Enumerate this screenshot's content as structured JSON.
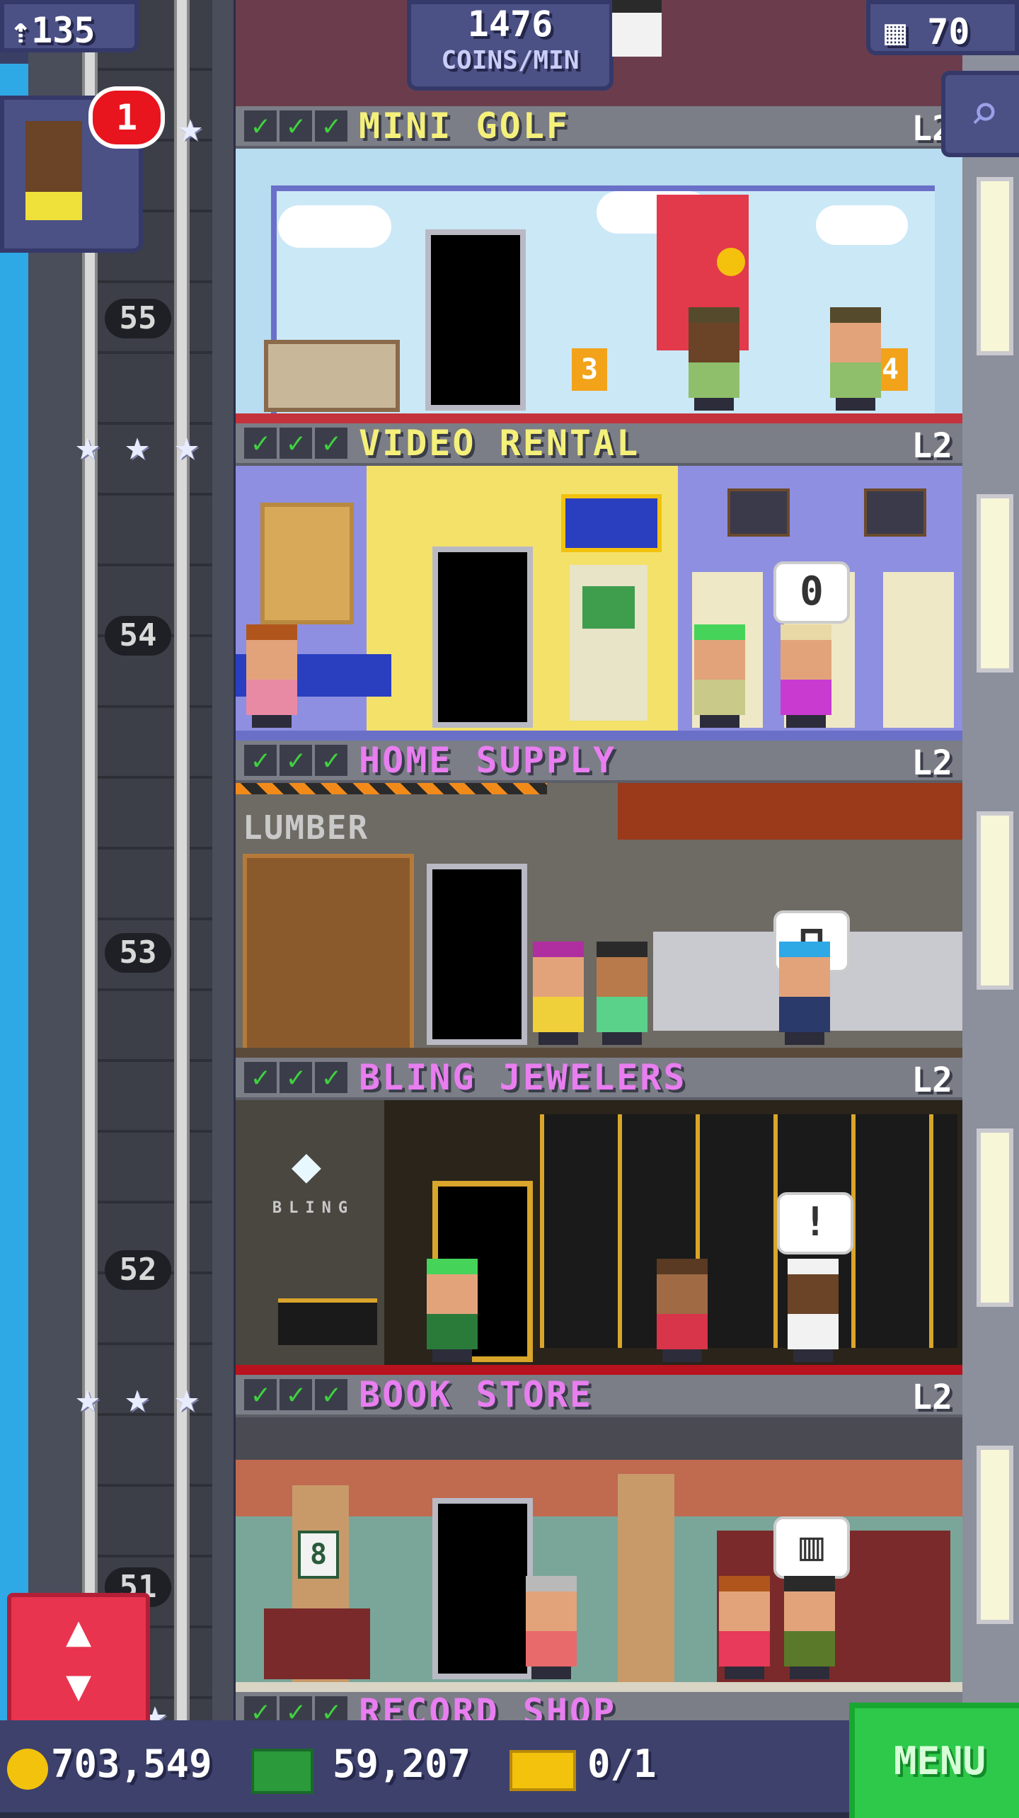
{
  "hud": {
    "population": "135",
    "coins_per_min_value": "1476",
    "coins_per_min_label": "COINS/MIN",
    "floors": "70",
    "notification_count": "1"
  },
  "floor_numbers": [
    "55",
    "54",
    "53",
    "52",
    "51"
  ],
  "floors": [
    {
      "name": "MINI GOLF",
      "level": "L2",
      "color": "#f4f07a"
    },
    {
      "name": "VIDEO RENTAL",
      "level": "L2",
      "color": "#f4f07a"
    },
    {
      "name": "HOME SUPPLY",
      "level": "L2",
      "color": "#e87ef0"
    },
    {
      "name": "BLING JEWELERS",
      "level": "L2",
      "color": "#e87ef0"
    },
    {
      "name": "BOOK STORE",
      "level": "L2",
      "color": "#e87ef0"
    },
    {
      "name": "RECORD SHOP",
      "level": "",
      "color": "#e87ef0"
    }
  ],
  "room_signs": {
    "lumber": "LUMBER",
    "bling_logo": "BLING",
    "golf_hole_3": "3",
    "golf_hole_4": "4",
    "video_bubble": "0",
    "jewel_bubble": "!",
    "book_sign": "8"
  },
  "bottom_bar": {
    "coins": "703,549",
    "bux": "59,207",
    "tickets": "0/1",
    "menu_label": "MENU"
  },
  "colors": {
    "sky": "#2fa8e6",
    "menu_green": "#2ec94b",
    "elevator_red": "#e8344f",
    "hud_blue": "#4b5085"
  }
}
